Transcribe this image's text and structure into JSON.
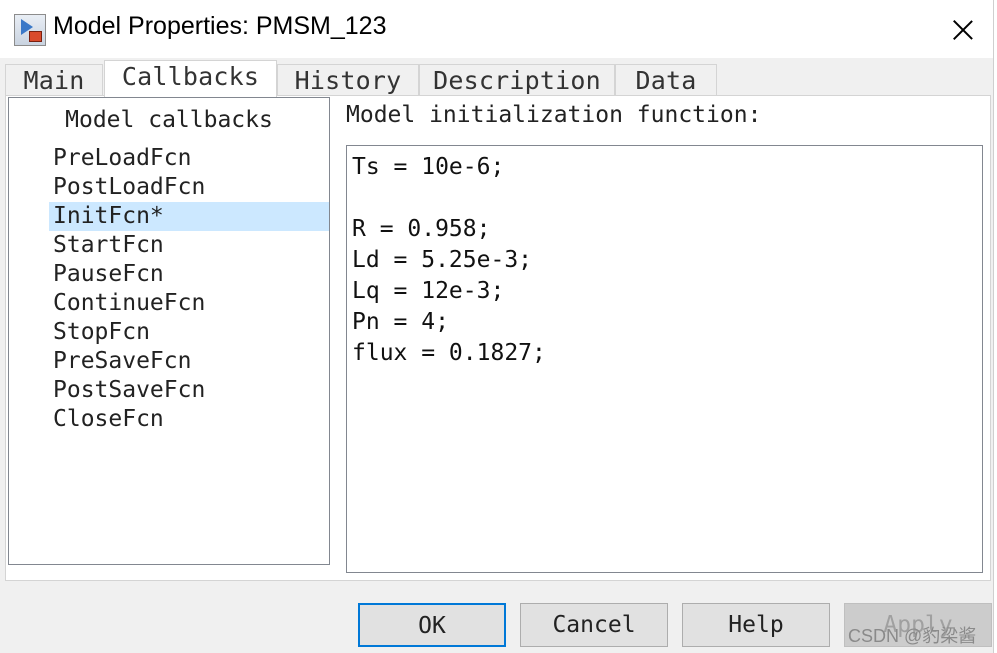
{
  "window": {
    "title": "Model Properties: PMSM_123",
    "icon": "simulink-model-icon",
    "close_icon": "close-icon"
  },
  "tabs": [
    {
      "label": "Main",
      "active": false
    },
    {
      "label": "Callbacks",
      "active": true
    },
    {
      "label": "History",
      "active": false
    },
    {
      "label": "Description",
      "active": false
    },
    {
      "label": "Data",
      "active": false
    }
  ],
  "callbacks": {
    "header": "Model callbacks",
    "items": [
      "PreLoadFcn",
      "PostLoadFcn",
      "InitFcn*",
      "StartFcn",
      "PauseFcn",
      "ContinueFcn",
      "StopFcn",
      "PreSaveFcn",
      "PostSaveFcn",
      "CloseFcn"
    ],
    "selected": "InitFcn*"
  },
  "editor": {
    "label": "Model initialization function:",
    "lines": [
      "Ts = 10e-6;",
      "",
      "R = 0.958;",
      "Ld = 5.25e-3;",
      "Lq = 12e-3;",
      "Pn = 4;",
      "flux = 0.1827;"
    ]
  },
  "buttons": {
    "ok": "OK",
    "cancel": "Cancel",
    "help": "Help",
    "apply": "Apply"
  },
  "watermark": "CSDN @豹梁酱",
  "colors": {
    "selection": "#cce8ff",
    "default_button_border": "#0078d7"
  }
}
